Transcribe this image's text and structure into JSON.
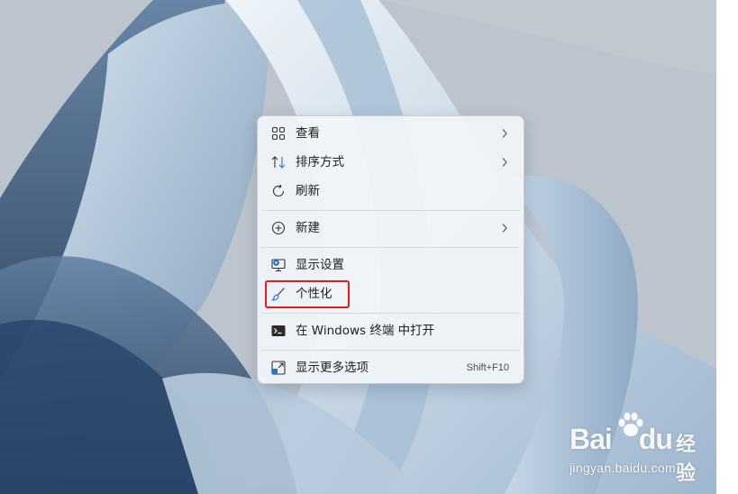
{
  "menu": {
    "items": [
      {
        "label": "查看",
        "icon": "grid-view-icon",
        "has_submenu": true
      },
      {
        "label": "排序方式",
        "icon": "sort-icon",
        "has_submenu": true
      },
      {
        "label": "刷新",
        "icon": "refresh-icon",
        "has_submenu": false
      },
      {
        "label": "新建",
        "icon": "new-plus-icon",
        "has_submenu": true
      },
      {
        "label": "显示设置",
        "icon": "display-settings-icon",
        "has_submenu": false
      },
      {
        "label": "个性化",
        "icon": "brush-icon",
        "has_submenu": false,
        "highlighted": true
      },
      {
        "label": "在 Windows 终端 中打开",
        "icon": "terminal-icon",
        "has_submenu": false
      },
      {
        "label": "显示更多选项",
        "icon": "more-options-icon",
        "shortcut": "Shift+F10"
      }
    ]
  },
  "watermark": {
    "brand": "Bai",
    "brand_suffix": "du",
    "product": "经验",
    "url": "jingyan.baidu.com"
  },
  "colors": {
    "highlight_box": "#e31b1b",
    "icon_accent": "#2a6fd6",
    "menu_background": "#f2f5f9"
  }
}
